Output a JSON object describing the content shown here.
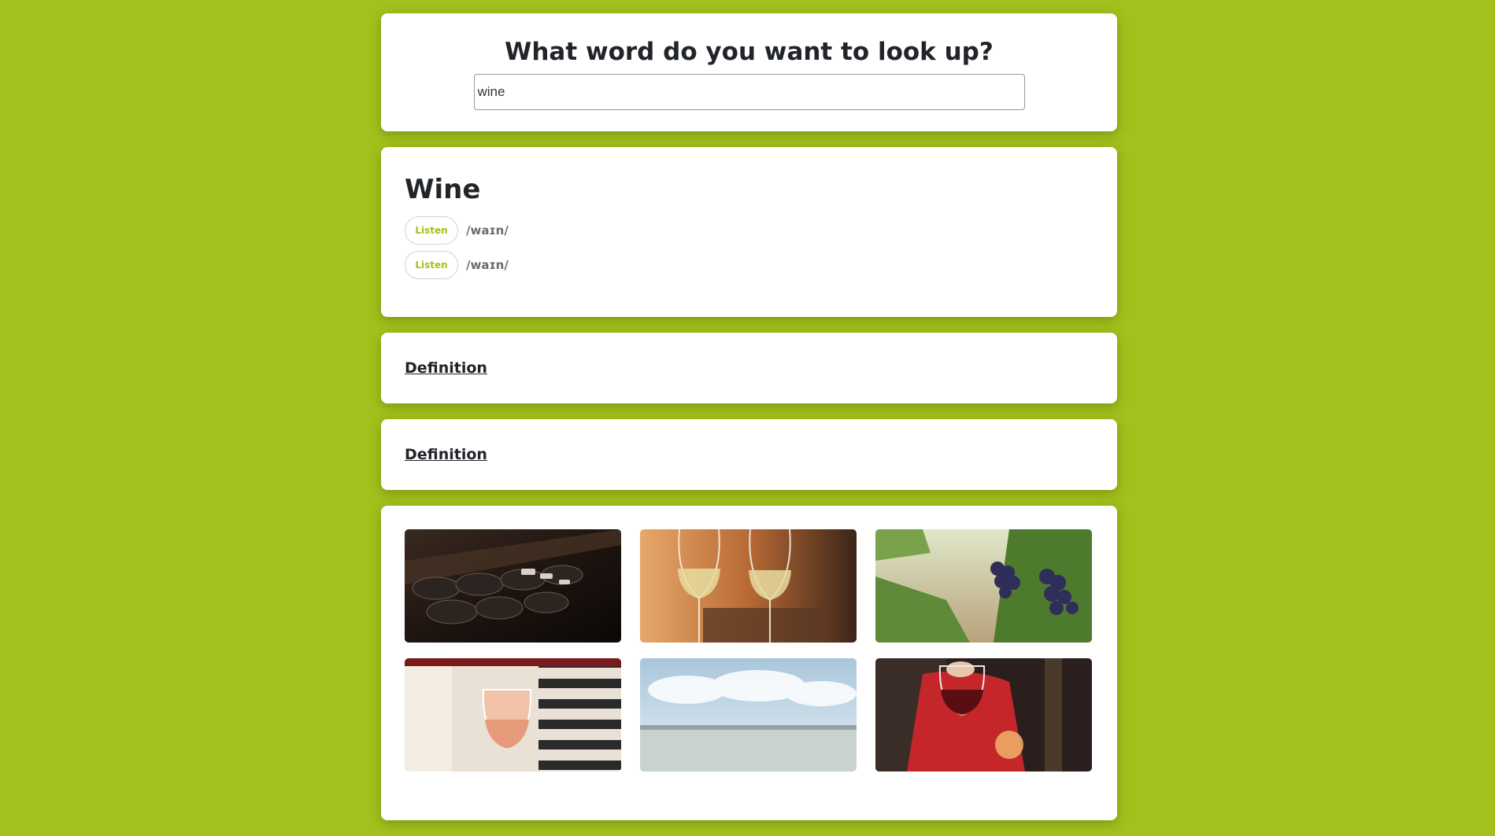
{
  "search": {
    "title": "What word do you want to look up?",
    "value": "wine"
  },
  "word": {
    "title": "Wine",
    "phonetics": [
      {
        "listen_label": "Listen",
        "text": "/waɪn/"
      },
      {
        "listen_label": "Listen",
        "text": "/waɪn/"
      }
    ]
  },
  "definitions": [
    {
      "heading": "Definition"
    },
    {
      "heading": "Definition"
    }
  ],
  "images": [
    {
      "name": "wine-bottles-rack-photo"
    },
    {
      "name": "white-wine-glasses-photo"
    },
    {
      "name": "grapes-vineyard-photo"
    },
    {
      "name": "rose-wine-glass-photo"
    },
    {
      "name": "sky-landscape-photo"
    },
    {
      "name": "red-wine-glass-photo"
    }
  ],
  "colors": {
    "background": "#a2c11c",
    "accent": "#a2c11c",
    "card": "#ffffff"
  }
}
